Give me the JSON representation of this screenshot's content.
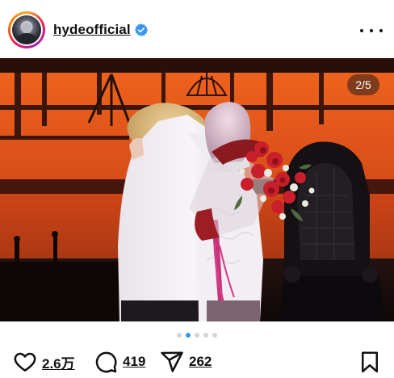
{
  "header": {
    "username": "hydeofficial",
    "verified": true,
    "avatar_icon": "profile-avatar",
    "more_icon": "more-horizontal-icon"
  },
  "media": {
    "counter_label": "2/5",
    "current_index": 2,
    "total": 5,
    "description": "stage-embrace-with-bouquet"
  },
  "carousel": {
    "active_dot": 2,
    "visible_dots": 5
  },
  "actions": {
    "likes": "2.6万",
    "comments": "419",
    "shares": "262",
    "like_icon": "heart-icon",
    "comment_icon": "comment-bubble-icon",
    "share_icon": "paper-plane-icon",
    "save_icon": "bookmark-icon"
  },
  "colors": {
    "accent": "#3897f0",
    "verified_badge": "#3897f0",
    "stage_orange": "#e05a1a"
  }
}
